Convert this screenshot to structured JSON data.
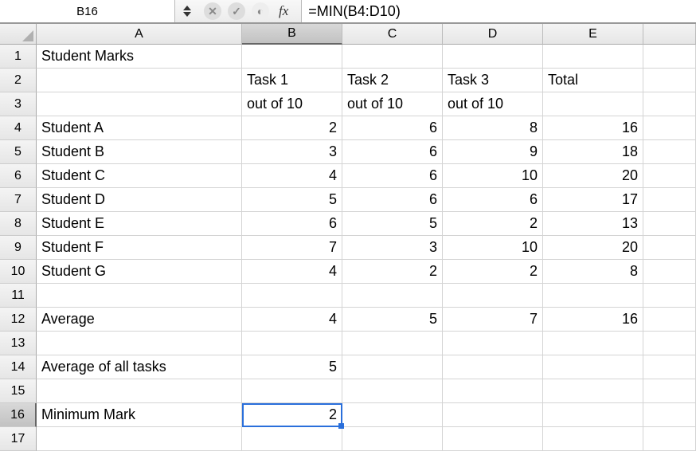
{
  "editor": {
    "cell_reference": "B16",
    "fx_label": "fx",
    "formula": "=MIN(B4:D10)"
  },
  "columns": [
    "A",
    "B",
    "C",
    "D",
    "E"
  ],
  "rows": [
    {
      "n": "1",
      "A": "Student Marks",
      "B": "",
      "C": "",
      "D": "",
      "E": ""
    },
    {
      "n": "2",
      "A": "",
      "B": "Task 1",
      "C": "Task 2",
      "D": "Task 3",
      "E": "Total"
    },
    {
      "n": "3",
      "A": "",
      "B": "out of 10",
      "C": "out of 10",
      "D": "out of 10",
      "E": ""
    },
    {
      "n": "4",
      "A": "Student A",
      "B": "2",
      "C": "6",
      "D": "8",
      "E": "16"
    },
    {
      "n": "5",
      "A": "Student B",
      "B": "3",
      "C": "6",
      "D": "9",
      "E": "18"
    },
    {
      "n": "6",
      "A": "Student C",
      "B": "4",
      "C": "6",
      "D": "10",
      "E": "20"
    },
    {
      "n": "7",
      "A": "Student D",
      "B": "5",
      "C": "6",
      "D": "6",
      "E": "17"
    },
    {
      "n": "8",
      "A": "Student E",
      "B": "6",
      "C": "5",
      "D": "2",
      "E": "13"
    },
    {
      "n": "9",
      "A": "Student F",
      "B": "7",
      "C": "3",
      "D": "10",
      "E": "20"
    },
    {
      "n": "10",
      "A": "Student G",
      "B": "4",
      "C": "2",
      "D": "2",
      "E": "8"
    },
    {
      "n": "11",
      "A": "",
      "B": "",
      "C": "",
      "D": "",
      "E": ""
    },
    {
      "n": "12",
      "A": "Average",
      "B": "4",
      "C": "5",
      "D": "7",
      "E": "16"
    },
    {
      "n": "13",
      "A": "",
      "B": "",
      "C": "",
      "D": "",
      "E": ""
    },
    {
      "n": "14",
      "A": "Average of all tasks",
      "B": "5",
      "C": "",
      "D": "",
      "E": ""
    },
    {
      "n": "15",
      "A": "",
      "B": "",
      "C": "",
      "D": "",
      "E": ""
    },
    {
      "n": "16",
      "A": "Minimum Mark",
      "B": "2",
      "C": "",
      "D": "",
      "E": ""
    },
    {
      "n": "17",
      "A": "",
      "B": "",
      "C": "",
      "D": "",
      "E": ""
    }
  ],
  "selected": {
    "row": 16,
    "col": "B"
  },
  "chart_data": {
    "type": "table",
    "title": "Student Marks",
    "columns": [
      "Student",
      "Task 1 (out of 10)",
      "Task 2 (out of 10)",
      "Task 3 (out of 10)",
      "Total"
    ],
    "rows": [
      [
        "Student A",
        2,
        6,
        8,
        16
      ],
      [
        "Student B",
        3,
        6,
        9,
        18
      ],
      [
        "Student C",
        4,
        6,
        10,
        20
      ],
      [
        "Student D",
        5,
        6,
        6,
        17
      ],
      [
        "Student E",
        6,
        5,
        2,
        13
      ],
      [
        "Student F",
        7,
        3,
        10,
        20
      ],
      [
        "Student G",
        4,
        2,
        2,
        8
      ]
    ],
    "summary": {
      "Average": [
        4,
        5,
        7,
        16
      ],
      "Average of all tasks": 5,
      "Minimum Mark": 2
    }
  }
}
